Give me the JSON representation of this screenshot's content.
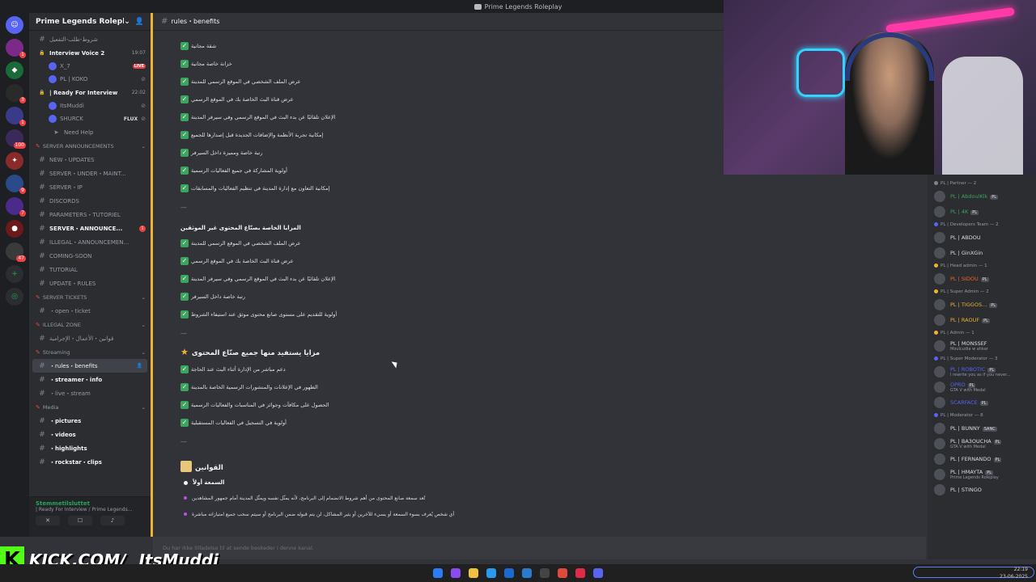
{
  "window": {
    "title": "Prime Legends Roleplay"
  },
  "server": {
    "name": "Prime Legends Roleplay"
  },
  "sidebar": {
    "rows": [
      {
        "kind": "channel",
        "label": "شروط-طلب-التفعيل",
        "hash": "#"
      },
      {
        "kind": "voice",
        "label": "Interview Voice 2",
        "meta": "19:07"
      },
      {
        "kind": "user",
        "label": "X_7",
        "live": "LIVE"
      },
      {
        "kind": "user",
        "label": "PL | KOKO"
      },
      {
        "kind": "voice",
        "label": "| Ready For Interview",
        "meta": "22:02"
      },
      {
        "kind": "user",
        "label": "ItsMuddi"
      },
      {
        "kind": "user",
        "label": "SHURCK",
        "flux": "FLUX"
      },
      {
        "kind": "thread",
        "label": "Need Help"
      },
      {
        "kind": "category",
        "label": "SERVER ANNOUNCEMENTS"
      },
      {
        "kind": "channel",
        "label": "NEW・UPDATES",
        "hash": "#"
      },
      {
        "kind": "channel",
        "label": "SERVER・UNDER・MAINT...",
        "hash": "#"
      },
      {
        "kind": "channel",
        "label": "SERVER・IP",
        "hash": "#"
      },
      {
        "kind": "channel",
        "label": "DISCORDS",
        "hash": "#"
      },
      {
        "kind": "channel",
        "label": "PARAMETERS・TUTORIEL",
        "hash": "#"
      },
      {
        "kind": "channel-bold",
        "label": "SERVER・ANNOUNCE...",
        "hash": "#",
        "badge": "1"
      },
      {
        "kind": "channel",
        "label": "ILLEGAL・ANNOUNCEMEN...",
        "hash": "#"
      },
      {
        "kind": "channel",
        "label": "COMING-SOON",
        "hash": "#"
      },
      {
        "kind": "channel",
        "label": "TUTORIAL",
        "hash": "#"
      },
      {
        "kind": "channel",
        "label": "UPDATE・RULES",
        "hash": "#"
      },
      {
        "kind": "category",
        "label": "SERVER TICKETS"
      },
      {
        "kind": "channel",
        "label": "・open・ticket",
        "hash": "#"
      },
      {
        "kind": "category",
        "label": "ILLEGAL ZONE"
      },
      {
        "kind": "channel",
        "label": "قوانين・الأعمال・الإجرامية",
        "hash": "#"
      },
      {
        "kind": "category",
        "label": "Streaming"
      },
      {
        "kind": "channel-active",
        "label": "・rules・benefits",
        "hash": "#"
      },
      {
        "kind": "channel-bold",
        "label": "・streamer・info",
        "hash": "#"
      },
      {
        "kind": "channel",
        "label": "・live・stream",
        "hash": "#"
      },
      {
        "kind": "category",
        "label": "Media"
      },
      {
        "kind": "channel-bold",
        "label": "・pictures",
        "hash": "#"
      },
      {
        "kind": "channel-bold",
        "label": "・videos",
        "hash": "#"
      },
      {
        "kind": "channel-bold",
        "label": "・highlights",
        "hash": "#"
      },
      {
        "kind": "channel-bold",
        "label": "・rockstar・clips",
        "hash": "#"
      }
    ]
  },
  "voice_panel": {
    "status": "Stemmetilsluttet",
    "channel": "| Ready For Interview / Prime Legends..."
  },
  "user_panel": {
    "name": "ItsMuddi"
  },
  "channel": {
    "name": "rules・benefits"
  },
  "messages": {
    "block1": [
      "شقة مجانية",
      "خزانة خاصة مجانية",
      "عرض الملف الشخصي في الموقع الرسمي للمدينة",
      "عرض قناة البث الخاصة بك في الموقع الرسمي",
      "الإعلان تلقائيًا عن بدء البث في الموقع الرسمي وفي سيرفر المدينة",
      "إمكانية تجربة الأنظمة والإضافات الجديدة قبل إصدارها للجميع",
      "رتبة خاصة ومميزة داخل السيرفر",
      "أولوية المشاركة في جميع الفعاليات الرسمية",
      "إمكانية التعاون مع إدارة المدينة في تنظيم الفعاليات والمسابقات"
    ],
    "sep": "—",
    "heading2": "المزايا الخاصة بصنّاع المحتوى غير الموثقين",
    "block2": [
      "عرض الملف الشخصي في الموقع الرسمي للمدينة",
      "عرض قناة البث الخاصة بك في الموقع الرسمي",
      "الإعلان تلقائيًا عن بدء البث في الموقع الرسمي وفي سيرفر المدينة",
      "رتبة خاصة داخل السيرفر",
      "أولوية للتقديم على مستوى صانع محتوى موثق عند استيفاء الشروط"
    ],
    "heading3": "مزايا يستفيد منها جميع صنّاع المحتوى",
    "block3": [
      "دعم مباشر من الإدارة أثناء البث عند الحاجة",
      "الظهور في الإعلانات والمنشورات الرسمية الخاصة بالمدينة",
      "الحصول على مكافآت وجوائز في المناسبات والفعاليات الرسمية",
      "أولوية في التسجيل في الفعاليات المستقبلية"
    ],
    "rules_heading": "القوانين",
    "rule1_title": "السمعة أولاً",
    "rule1_items": [
      "تُعد سمعة صانع المحتوى من أهم شروط الانضمام إلى البرنامج، لأنه يمثّل نفسه ويمثّل المدينة أمام جمهور المشاهدين",
      "أي شخص يُعرف بسوء السمعة أو يسيء للآخرين أو يثير المشاكل، لن يتم قبوله ضمن البرنامج أو سيتم سحب جميع امتيازاته مباشرة"
    ]
  },
  "composer": {
    "placeholder": "Du har ikke tilladelse til at sende beskeder i denne kanal."
  },
  "members": {
    "groups": [
      {
        "role": "PL | Partner — 2",
        "color": "#80848e",
        "members": [
          {
            "name": "PL | AbdoulKlk",
            "color": "#3ba55d",
            "tag": "PL"
          },
          {
            "name": "PL | 4K",
            "color": "#3ba55d",
            "tag": "PL"
          }
        ]
      },
      {
        "role": "PL | Developers Team — 2",
        "color": "#5865f2",
        "members": [
          {
            "name": "PL | ABDOU",
            "color": "#dbdee1"
          },
          {
            "name": "PL | GinXGin",
            "color": "#dbdee1"
          }
        ]
      },
      {
        "role": "PL | Head admin — 1",
        "color": "#f0b232",
        "members": [
          {
            "name": "PL | SIDOU",
            "color": "#f26522",
            "tag": "PL"
          }
        ]
      },
      {
        "role": "PL | Super Admin — 2",
        "color": "#f0b232",
        "members": [
          {
            "name": "PL | TIGGOS...",
            "color": "#f0b232",
            "tag": "PL"
          },
          {
            "name": "PL | RAOUF",
            "color": "#f0b232",
            "tag": "PL"
          }
        ]
      },
      {
        "role": "PL | Admin — 1",
        "color": "#f0b232",
        "members": [
          {
            "name": "PL | MONSSEF",
            "color": "#dbdee1",
            "status": "Moulcudia w ahkar"
          }
        ]
      },
      {
        "role": "PL | Super Moderator — 3",
        "color": "#5865f2",
        "members": [
          {
            "name": "PL | ROBOTIC",
            "color": "#5865f2",
            "tag": "PL",
            "status": "I rewrite you as if you never..."
          },
          {
            "name": "OPRO",
            "color": "#5865f2",
            "tag": "PL",
            "status": "GTA V with Medal"
          },
          {
            "name": "SCARFACE",
            "color": "#5865f2",
            "tag": "PL"
          }
        ]
      },
      {
        "role": "PL | Moderator — 8",
        "color": "#5865f2",
        "members": [
          {
            "name": "PL | BUNNY",
            "color": "#dbdee1",
            "tag": "SANC"
          },
          {
            "name": "PL | BA3OUCHA",
            "color": "#dbdee1",
            "tag": "PL",
            "status": "GTA V with Medal"
          },
          {
            "name": "PL | FERNANDO",
            "color": "#dbdee1",
            "tag": "PL"
          },
          {
            "name": "PL | HMAYTA",
            "color": "#dbdee1",
            "tag": "PL",
            "status": "Prime Legends Roleplay"
          },
          {
            "name": "PL | STINGO",
            "color": "#dbdee1"
          }
        ]
      }
    ]
  },
  "overlay": {
    "kick_label": "KICK.COM/",
    "kick_user": "ItsMuddi"
  },
  "taskbar": {
    "time": "22:19",
    "date": "23-06-2025"
  },
  "colors": {
    "accent": "#5865f2",
    "online": "#23a559",
    "check": "#3ba55d",
    "kick": "#53fc18",
    "divider": "#f0b232"
  }
}
